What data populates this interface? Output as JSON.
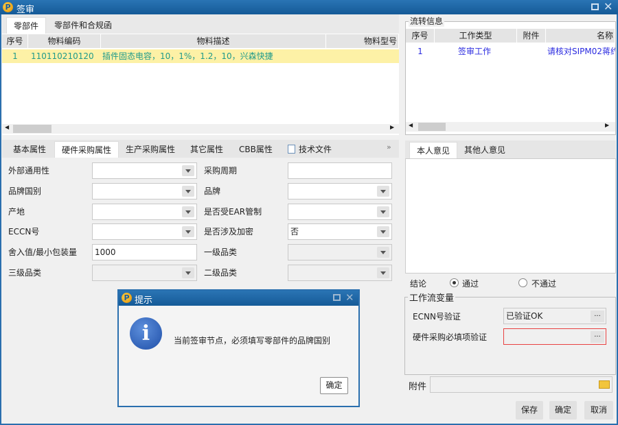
{
  "window": {
    "title": "签审"
  },
  "top_tabs": [
    "零部件",
    "零部件和合规函"
  ],
  "parts_table": {
    "headers": [
      "序号",
      "物料编码",
      "物料描述",
      "物料型号"
    ],
    "rows": [
      [
        "1",
        "110110210120",
        "插件固态电容，10，1%，1.2，10，兴森快捷",
        ""
      ]
    ]
  },
  "attr_tabs": [
    "基本属性",
    "硬件采购属性",
    "生产采购属性",
    "其它属性",
    "CBB属性",
    "技术文件"
  ],
  "form": {
    "left": [
      {
        "label": "外部通用性",
        "value": ""
      },
      {
        "label": "品牌国别",
        "value": ""
      },
      {
        "label": "产地",
        "value": ""
      },
      {
        "label": "ECCN号",
        "value": ""
      },
      {
        "label": "舍入值/最小包装量",
        "value": "1000"
      },
      {
        "label": "三级品类",
        "value": ""
      }
    ],
    "right": [
      {
        "label": "采购周期",
        "value": ""
      },
      {
        "label": "品牌",
        "value": ""
      },
      {
        "label": "是否受EAR管制",
        "value": ""
      },
      {
        "label": "是否涉及加密",
        "value": "否"
      },
      {
        "label": "一级品类",
        "value": ""
      },
      {
        "label": "二级品类",
        "value": ""
      }
    ]
  },
  "flow": {
    "title": "流转信息",
    "headers": [
      "序号",
      "工作类型",
      "附件",
      "名称"
    ],
    "rows": [
      [
        "1",
        "签审工作",
        "",
        "请核对SIPM02蒋约"
      ]
    ]
  },
  "opinion_tabs": [
    "本人意见",
    "其他人意见"
  ],
  "conclusion": {
    "label": "结论",
    "options": [
      "通过",
      "不通过"
    ],
    "selected": "通过"
  },
  "workflow_vars": {
    "title": "工作流变量",
    "items": [
      {
        "label": "ECNN号验证",
        "value": "已验证OK",
        "button": "..."
      },
      {
        "label": "硬件采购必填项验证",
        "value": "",
        "button": "..."
      }
    ]
  },
  "attachment": {
    "label": "附件",
    "value": ""
  },
  "buttons": {
    "save": "保存",
    "ok": "确定",
    "cancel": "取消"
  },
  "dialog": {
    "title": "提示",
    "message": "当前签审节点，必须填写零部件的品牌国别",
    "ok": "确定"
  }
}
